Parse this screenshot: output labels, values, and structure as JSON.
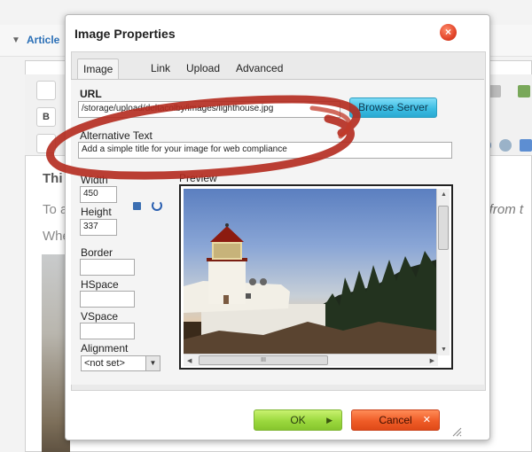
{
  "background": {
    "article_header": "Article",
    "heading_text": "Thi",
    "para1": "To a",
    "para2": "Whe",
    "right_text": "icon from t"
  },
  "dialog": {
    "title": "Image Properties",
    "close_symbol": "×",
    "tabs": [
      {
        "label": "Image Info"
      },
      {
        "label": "Link"
      },
      {
        "label": "Upload"
      },
      {
        "label": "Advanced"
      }
    ],
    "url_label": "URL",
    "url_value": "/storage/upload/deltacolby/images/lighthouse.jpg",
    "browse_button": "Browse Server",
    "alt_label": "Alternative Text",
    "alt_value": "Add a simple title for your image for web compliance",
    "width_label": "Width",
    "width_value": "450",
    "height_label": "Height",
    "height_value": "337",
    "border_label": "Border",
    "border_value": "",
    "hspace_label": "HSpace",
    "hspace_value": "",
    "vspace_label": "VSpace",
    "vspace_value": "",
    "alignment_label": "Alignment",
    "alignment_value": "<not set>",
    "preview_label": "Preview",
    "scroll_grip": "III",
    "ok_button": "OK",
    "cancel_button": "Cancel"
  },
  "colors": {
    "ok_green": "#9bd83e",
    "cancel_orange": "#ef5c27",
    "browse_blue": "#3cbde3",
    "annotation_red": "#b42a1e"
  }
}
